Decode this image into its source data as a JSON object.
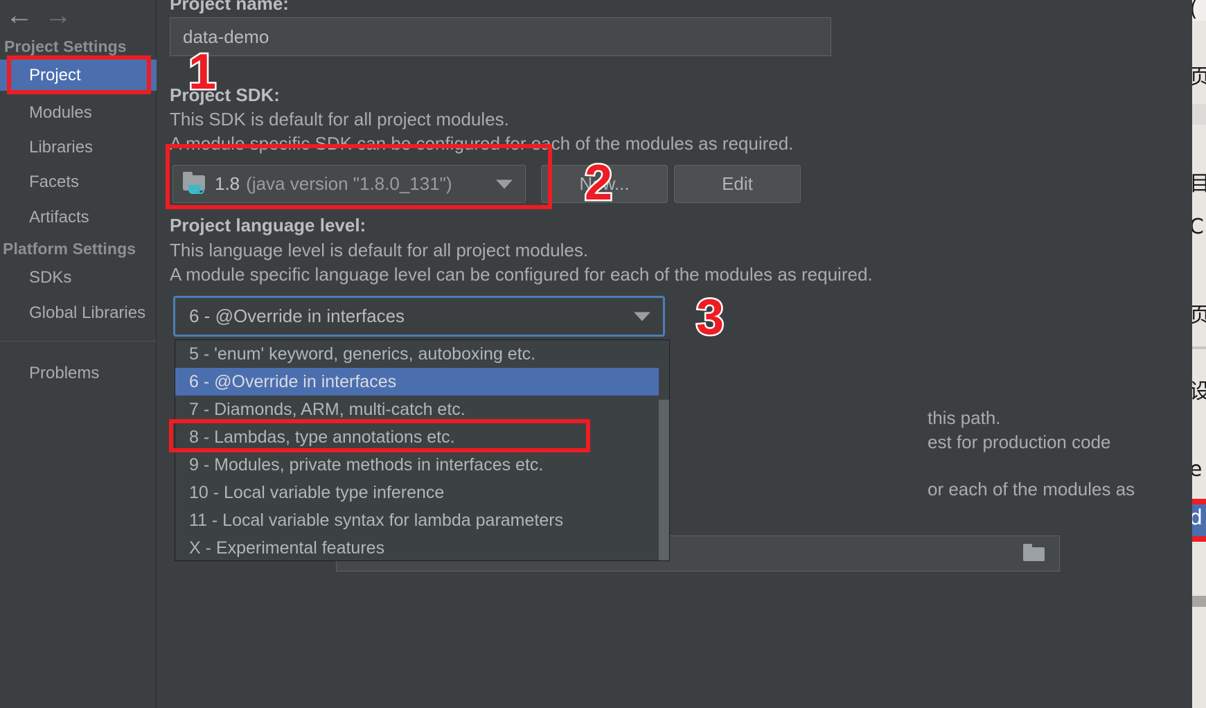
{
  "sidebar": {
    "nav": {
      "back_icon": "arrow-left-icon",
      "forward_icon": "arrow-right-icon"
    },
    "group_project": "Project Settings",
    "group_platform": "Platform Settings",
    "items": [
      {
        "label": "Project",
        "selected": true
      },
      {
        "label": "Modules",
        "selected": false
      },
      {
        "label": "Libraries",
        "selected": false
      },
      {
        "label": "Facets",
        "selected": false
      },
      {
        "label": "Artifacts",
        "selected": false
      },
      {
        "label": "SDKs",
        "selected": false
      },
      {
        "label": "Global Libraries",
        "selected": false
      },
      {
        "label": "Problems",
        "selected": false
      }
    ]
  },
  "main": {
    "project_name_label": "Project name:",
    "project_name_value": "data-demo",
    "sdk_label": "Project SDK:",
    "sdk_desc_line1": "This SDK is default for all project modules.",
    "sdk_desc_line2": "A module specific SDK can be configured for each of the modules as required.",
    "sdk_version": "1.8",
    "sdk_detail": "(java version \"1.8.0_131\")",
    "sdk_icon": "folder-java-icon",
    "btn_new": "New...",
    "btn_edit": "Edit",
    "lang_label": "Project language level:",
    "lang_desc_line1": "This language level is default for all project modules.",
    "lang_desc_line2": "A module specific language level can be configured for each of the modules as required.",
    "lang_selected": "6 - @Override in interfaces",
    "background_text": {
      "line_path": "this path.",
      "line_prod": "est for production code",
      "line_mods": "or each of the modules as"
    }
  },
  "dropdown": {
    "options": [
      {
        "label": "5 - 'enum' keyword, generics, autoboxing etc.",
        "highlighted": false
      },
      {
        "label": "6 - @Override in interfaces",
        "highlighted": true
      },
      {
        "label": "7 - Diamonds, ARM, multi-catch etc.",
        "highlighted": false
      },
      {
        "label": "8 - Lambdas, type annotations etc.",
        "highlighted": false
      },
      {
        "label": "9 - Modules, private methods in interfaces etc.",
        "highlighted": false
      },
      {
        "label": "10 - Local variable type inference",
        "highlighted": false
      },
      {
        "label": "11 - Local variable syntax for lambda parameters",
        "highlighted": false
      },
      {
        "label": "X - Experimental features",
        "highlighted": false
      }
    ]
  },
  "annotations": {
    "numbers": [
      "1",
      "2",
      "3"
    ],
    "color": "#ee1c23"
  },
  "colors": {
    "background": "#3c3f41",
    "selection_blue": "#4b6eaf",
    "focus_ring": "#4b7fb5",
    "annotation_red": "#ee1c23",
    "field_background": "#45494a"
  }
}
